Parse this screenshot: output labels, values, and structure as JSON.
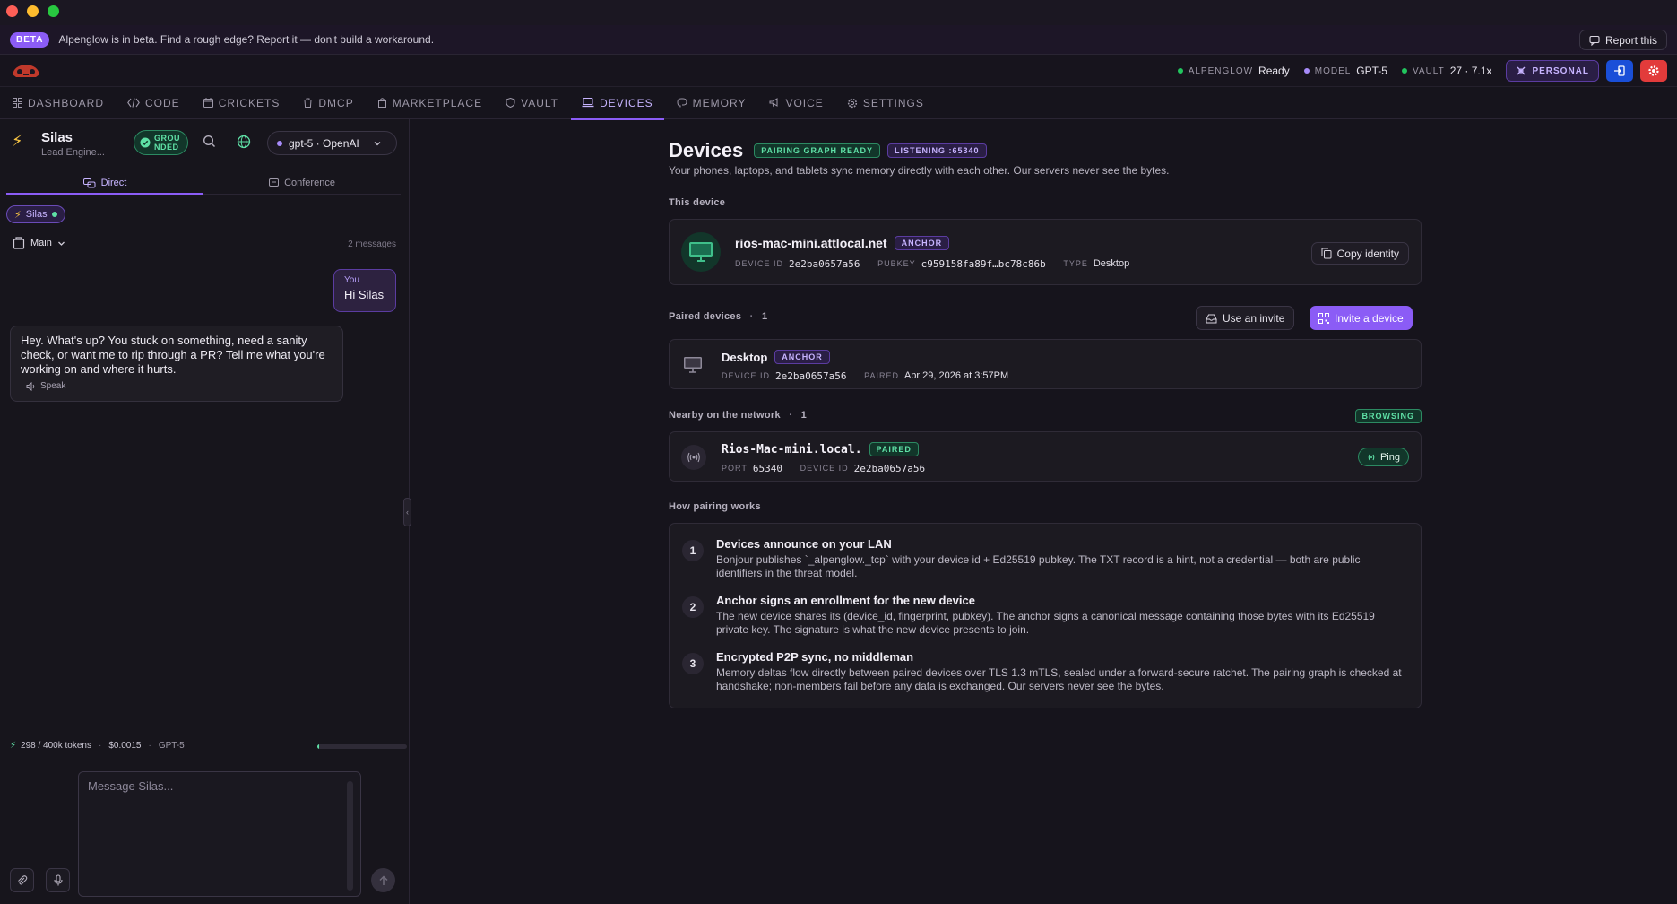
{
  "beta": {
    "badge": "BETA",
    "message": "Alpenglow is in beta. Find a rough edge? Report it — don't build a workaround.",
    "report_label": "Report this"
  },
  "header": {
    "status": [
      {
        "label": "ALPENGLOW",
        "value": "Ready",
        "color": "#22c55e"
      },
      {
        "label": "MODEL",
        "value": "GPT-5",
        "color": "#a78bfa"
      },
      {
        "label": "VAULT",
        "value": "27 · 7.1x",
        "color": "#22c55e"
      }
    ],
    "workspace_label": "PERSONAL"
  },
  "nav": {
    "items": [
      {
        "label": "DASHBOARD",
        "icon": "grid-icon"
      },
      {
        "label": "CODE",
        "icon": "code-icon"
      },
      {
        "label": "CRICKETS",
        "icon": "calendar-icon"
      },
      {
        "label": "DMCP",
        "icon": "trash-icon"
      },
      {
        "label": "MARKETPLACE",
        "icon": "bag-icon"
      },
      {
        "label": "VAULT",
        "icon": "shield-icon"
      },
      {
        "label": "DEVICES",
        "icon": "laptop-icon"
      },
      {
        "label": "MEMORY",
        "icon": "brain-icon"
      },
      {
        "label": "VOICE",
        "icon": "megaphone-icon"
      },
      {
        "label": "SETTINGS",
        "icon": "gear-icon"
      }
    ],
    "active": "DEVICES"
  },
  "chat": {
    "agent_name": "Silas",
    "agent_role": "Lead Engine...",
    "grounded_label": "GROU NDED",
    "model_label": "gpt-5 · OpenAI",
    "tabs": [
      {
        "label": "Direct"
      },
      {
        "label": "Conference"
      }
    ],
    "chip_label": "Silas",
    "branch_label": "Main",
    "message_count": "2 messages",
    "user_label": "You",
    "user_message": "Hi Silas",
    "ai_message": "Hey. What's up? You stuck on something, need a sanity check, or want me to rip through a PR? Tell me what you're working on and where it hurts.",
    "speak_label": "Speak",
    "tokens": "298 / 400k tokens",
    "token_fraction": 0.007,
    "cost": "$0.0015",
    "model_short": "GPT-5",
    "input_placeholder": "Message Silas..."
  },
  "devices": {
    "title": "Devices",
    "badge_graph": "PAIRING GRAPH READY",
    "badge_listening": "LISTENING :65340",
    "subtitle": "Your phones, laptops, and tablets sync memory directly with each other. Our servers never see the bytes.",
    "this_device": {
      "section": "This device",
      "hostname": "rios-mac-mini.attlocal.net",
      "badge": "ANCHOR",
      "device_id_label": "DEVICE ID",
      "device_id": "2e2ba0657a56",
      "pubkey_label": "PUBKEY",
      "pubkey": "c959158fa89f…bc78c86b",
      "type_label": "TYPE",
      "type": "Desktop",
      "copy_label": "Copy identity"
    },
    "paired": {
      "section": "Paired devices",
      "count": "1",
      "invite_label": "Use an invite",
      "invite_device_label": "Invite a device",
      "name": "Desktop",
      "badge": "ANCHOR",
      "device_id_label": "DEVICE ID",
      "device_id": "2e2ba0657a56",
      "paired_label": "PAIRED",
      "paired_at": "Apr 29, 2026 at 3:57PM"
    },
    "nearby": {
      "section": "Nearby on the network",
      "count": "1",
      "status": "BROWSING",
      "name": "Rios-Mac-mini.local.",
      "badge": "PAIRED",
      "port_label": "PORT",
      "port": "65340",
      "device_id_label": "DEVICE ID",
      "device_id": "2e2ba0657a56",
      "ping_label": "Ping"
    },
    "how": {
      "section": "How pairing works",
      "steps": [
        {
          "num": "1",
          "title": "Devices announce on your LAN",
          "body": "Bonjour publishes `_alpenglow._tcp` with your device id + Ed25519 pubkey. The TXT record is a hint, not a credential — both are public identifiers in the threat model."
        },
        {
          "num": "2",
          "title": "Anchor signs an enrollment for the new device",
          "body": "The new device shares its (device_id, fingerprint, pubkey). The anchor signs a canonical message containing those bytes with its Ed25519 private key. The signature is what the new device presents to join."
        },
        {
          "num": "3",
          "title": "Encrypted P2P sync, no middleman",
          "body": "Memory deltas flow directly between paired devices over TLS 1.3 mTLS, sealed under a forward-secure ratchet. The pairing graph is checked at handshake; non-members fail before any data is exchanged. Our servers never see the bytes."
        }
      ]
    }
  }
}
